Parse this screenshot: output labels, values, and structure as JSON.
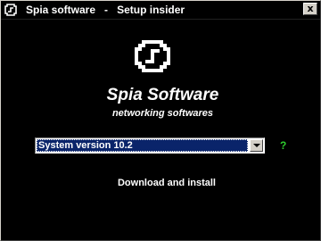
{
  "window": {
    "title_app": "Spia software",
    "title_separator": "-",
    "title_page": "Setup insider",
    "close_label": "x"
  },
  "brand": {
    "name": "Spia Software",
    "tagline": "networking softwares"
  },
  "version_select": {
    "selected": "System version 10.2"
  },
  "help": {
    "label": "?"
  },
  "actions": {
    "install_label": "Download and install"
  },
  "colors": {
    "background": "#000000",
    "text": "#ffffff",
    "selection": "#0a246a",
    "help": "#2ecc2e"
  },
  "icons": {
    "app": "spia-logo-icon",
    "close": "close-icon",
    "dropdown": "chevron-down-icon"
  }
}
